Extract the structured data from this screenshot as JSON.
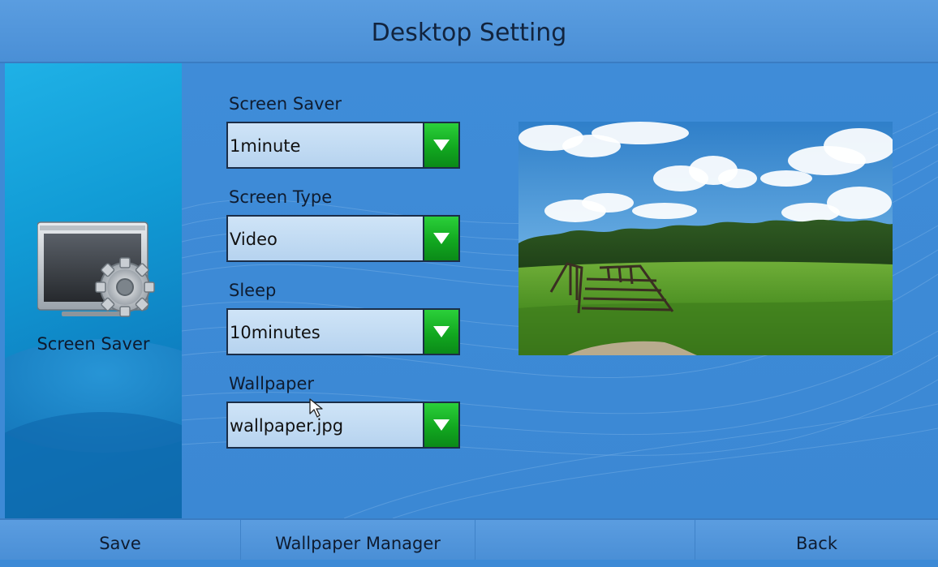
{
  "header": {
    "title": "Desktop Setting"
  },
  "sidebar": {
    "label": "Screen Saver",
    "icon": "monitor-gear-icon"
  },
  "form": {
    "screen_saver": {
      "label": "Screen Saver",
      "value": "1minute"
    },
    "screen_type": {
      "label": "Screen Type",
      "value": "Video"
    },
    "sleep": {
      "label": "Sleep",
      "value": "10minutes"
    },
    "wallpaper": {
      "label": "Wallpaper",
      "value": "wallpaper.jpg"
    }
  },
  "preview": {
    "subject": "wallpaper-preview"
  },
  "footer": {
    "save": "Save",
    "wallpaper_manager": "Wallpaper Manager",
    "empty": "",
    "back": "Back"
  },
  "colors": {
    "accent_green": "#12a820",
    "panel_blue": "#3d8ad6",
    "sidebar_cyan": "#1fb1e6",
    "dropdown_fill": "#cfe4f7"
  }
}
